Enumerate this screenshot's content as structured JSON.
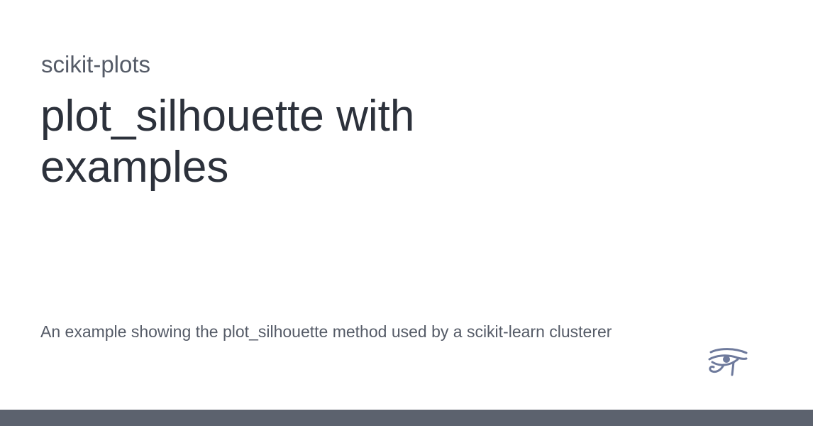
{
  "site": {
    "name": "scikit-plots"
  },
  "article": {
    "title": "plot_silhouette with examples",
    "description": "An example showing the plot_silhouette method used by a scikit-learn clusterer"
  },
  "logo": {
    "icon": "eye-of-horus-icon",
    "color": "#6e7a9c"
  },
  "colors": {
    "footer_bar": "#5c626e",
    "title_text": "#2c313b",
    "muted_text": "#555b67"
  }
}
